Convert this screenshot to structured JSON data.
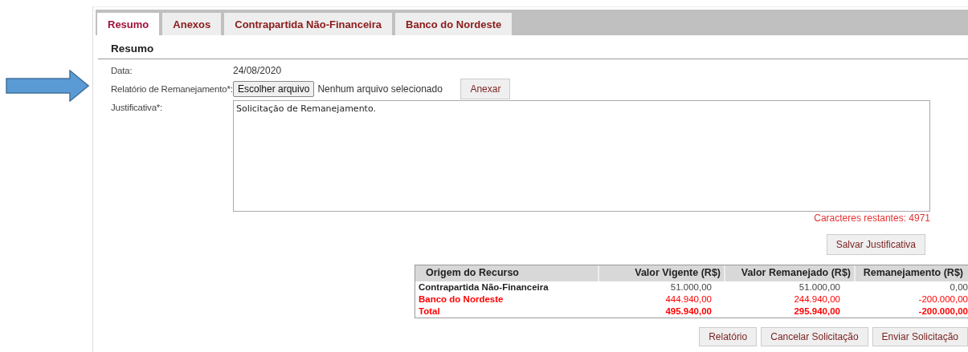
{
  "tabs": [
    {
      "label": "Resumo",
      "selected": true
    },
    {
      "label": "Anexos",
      "selected": false
    },
    {
      "label": "Contrapartida Não-Financeira",
      "selected": false
    },
    {
      "label": "Banco do Nordeste",
      "selected": false
    }
  ],
  "section_title": "Resumo",
  "form": {
    "data_label": "Data:",
    "data_value": "24/08/2020",
    "report_label": "Relatório de Remanejamento*:",
    "file_button": "Escolher arquivo",
    "file_status": "Nenhum arquivo selecionado",
    "attach_button": "Anexar",
    "justification_label": "Justificativa*:",
    "justification_value": "Solicitação de Remanejamento.",
    "remaining_chars": "Caracteres restantes: 4971",
    "save_button": "Salvar Justificativa"
  },
  "table": {
    "columns": [
      "Origem do Recurso",
      "Valor Vigente (R$)",
      "Valor Remanejado (R$)",
      "Remanejamento (R$)"
    ],
    "rows": [
      {
        "kind": "normal",
        "cells": [
          "Contrapartida Não-Financeira",
          "51.000,00",
          "51.000,00",
          "0,00"
        ]
      },
      {
        "kind": "highlight",
        "cells": [
          "Banco do Nordeste",
          "444.940,00",
          "244.940,00",
          "-200.000,00"
        ]
      },
      {
        "kind": "total",
        "cells": [
          "Total",
          "495.940,00",
          "295.940,00",
          "-200.000,00"
        ]
      }
    ]
  },
  "buttons": [
    "Relatório",
    "Cancelar Solicitação",
    "Enviar Solicitação"
  ]
}
